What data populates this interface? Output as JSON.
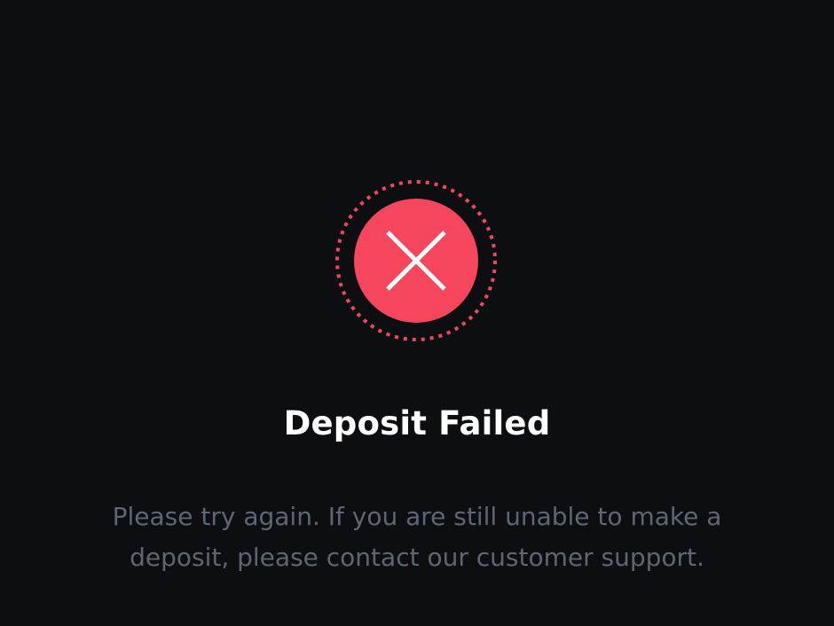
{
  "result": {
    "title": "Deposit Failed",
    "message": "Please try again. If you are still unable to make a deposit, please contact our customer support.",
    "icon": "error-x-icon"
  },
  "colors": {
    "background": "#0c0e11",
    "error": "#f6465d",
    "title": "#ffffff",
    "message": "#5e6673"
  }
}
